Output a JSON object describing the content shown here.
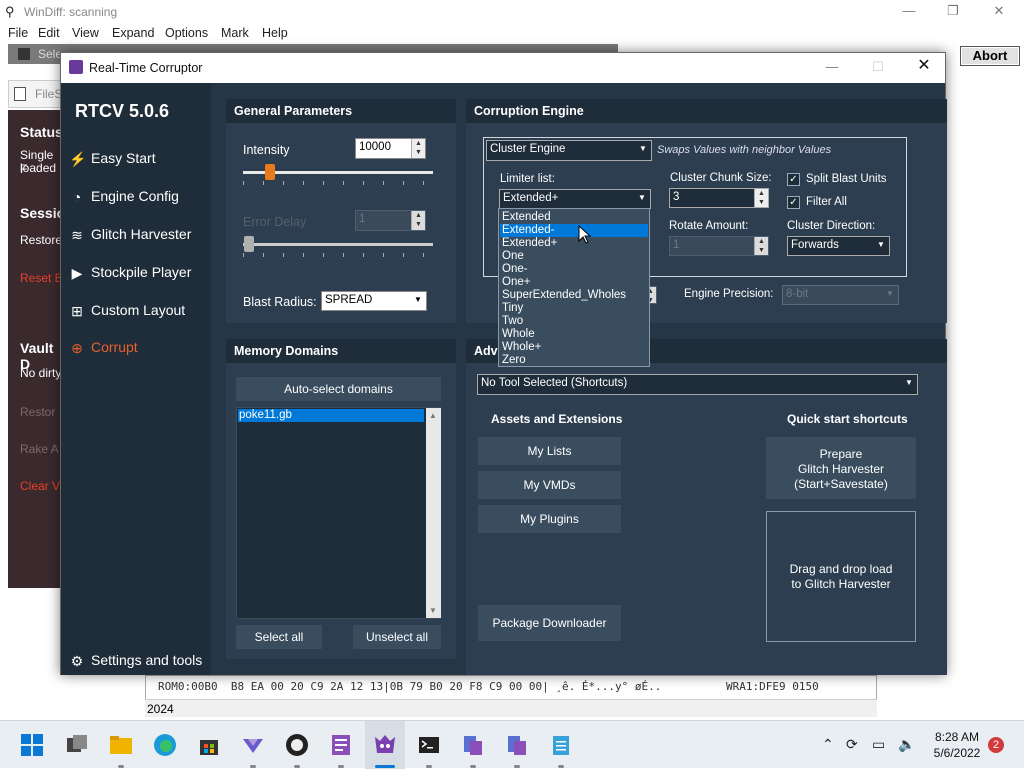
{
  "windiff": {
    "title": "WinDiff: scanning",
    "menu": [
      "File",
      "Edit",
      "View",
      "Expand",
      "Options",
      "Mark",
      "Help"
    ],
    "abort_label": "Abort",
    "select_tab": "Sele",
    "file_tab": "FileS",
    "side": {
      "status": "Status",
      "single_f": "Single F",
      "loaded": "loaded",
      "session": "Sessio",
      "restore": "Restore",
      "reset": "Reset B",
      "vault": "Vault D",
      "no_dirty": "No dirty",
      "restor2": "Restor",
      "rake": "Rake A",
      "clear": "Clear V"
    },
    "hex_line1": "ROM0:00B0  B8 EA 00 20 C9 2A 12 13|0B 79 B0 20 F8 C9 00 00| ¸ê. É*...y° øÉ..",
    "hex_right1": "WRA1:DFE9 0150",
    "status_value": "2024"
  },
  "rtcv": {
    "title": "Real-Time Corruptor",
    "version": "RTCV 5.0.6",
    "nav": {
      "easy_start": "Easy Start",
      "engine_config": "Engine Config",
      "glitch_harvester": "Glitch Harvester",
      "stockpile_player": "Stockpile Player",
      "custom_layout": "Custom Layout",
      "corrupt": "Corrupt",
      "settings": "Settings and tools"
    },
    "general": {
      "header": "General Parameters",
      "intensity_label": "Intensity",
      "intensity_value": "10000",
      "error_delay_label": "Error Delay",
      "error_delay_value": "1",
      "blast_radius_label": "Blast Radius:",
      "blast_radius_value": "SPREAD"
    },
    "memory": {
      "header": "Memory Domains",
      "autoselect": "Auto-select domains",
      "domains": [
        "poke11.gb"
      ],
      "select_all": "Select all",
      "unselect_all": "Unselect all"
    },
    "engine": {
      "header": "Corruption Engine",
      "engine_value": "Cluster Engine",
      "engine_desc": "Swaps Values with neighbor Values",
      "limiter_label": "Limiter list:",
      "limiter_value": "Extended+",
      "chunk_label": "Cluster Chunk Size:",
      "chunk_value": "3",
      "split_label": "Split Blast Units",
      "filter_label": "Filter All",
      "rotate_label": "Rotate Amount:",
      "rotate_value": "1",
      "direction_label": "Cluster Direction:",
      "direction_value": "Forwards",
      "precision_label": "Engine Precision:",
      "precision_value": "8-bit",
      "dropdown_options": [
        "Extended",
        "Extended-",
        "Extended+",
        "One",
        "One-",
        "One+",
        "SuperExtended_Wholes",
        "Tiny",
        "Two",
        "Whole",
        "Whole+",
        "Zero"
      ],
      "dropdown_selected": "Extended-"
    },
    "advanced": {
      "header": "Adva",
      "tool_select": "No Tool Selected (Shortcuts)",
      "assets_label": "Assets and Extensions",
      "quick_label": "Quick start shortcuts",
      "my_lists": "My Lists",
      "my_vmds": "My VMDs",
      "my_plugins": "My Plugins",
      "package_downloader": "Package Downloader",
      "prepare_line1": "Prepare",
      "prepare_line2": "Glitch Harvester",
      "prepare_line3": "(Start+Savestate)",
      "drop_line1": "Drag and drop load",
      "drop_line2": "to Glitch Harvester"
    }
  },
  "taskbar": {
    "time": "8:28 AM",
    "date": "5/6/2022",
    "notifications": "2"
  },
  "colors": {
    "accent_orange": "#e87a1a",
    "selection_blue": "#0078d7",
    "corrupt_red": "#e8402a"
  }
}
